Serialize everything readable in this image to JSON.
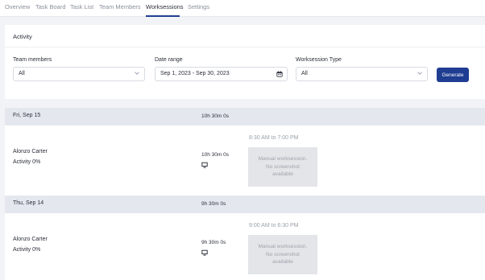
{
  "tabs": [
    {
      "label": "Overview"
    },
    {
      "label": "Task Board"
    },
    {
      "label": "Task List"
    },
    {
      "label": "Team Members"
    },
    {
      "label": "Worksessions"
    },
    {
      "label": "Settings"
    }
  ],
  "active_tab": "Worksessions",
  "panel": {
    "title": "Activity"
  },
  "filters": {
    "team_members": {
      "label": "Team members",
      "value": "All"
    },
    "date_range": {
      "label": "Date range",
      "value": "Sep 1, 2023 - Sep 30, 2023"
    },
    "worksession_type": {
      "label": "Worksession Type",
      "value": "All"
    },
    "generate_label": "Generate"
  },
  "days": [
    {
      "date": "Fri, Sep 15",
      "total": "10h 30m 0s",
      "entry": {
        "name": "Alonzo Carter",
        "activity": "Activity 0%",
        "duration": "10h 30m 0s",
        "time_range": "8:30 AM to 7:00 PM",
        "card_line1": "Manual worksession.",
        "card_line2": "No screenshot",
        "card_line3": "available"
      }
    },
    {
      "date": "Thu, Sep 14",
      "total": "9h 30m 0s",
      "entry": {
        "name": "Alonzo Carter",
        "activity": "Activity 0%",
        "duration": "9h 30m 0s",
        "time_range": "9:00 AM to 6:30 PM",
        "card_line1": "Manual worksession.",
        "card_line2": "No screenshot",
        "card_line3": "available"
      }
    }
  ],
  "colors": {
    "accent": "#1f3d91",
    "header_band": "#e4e8ee",
    "page_bg": "#f2f3f6"
  },
  "icons": {
    "date_picker": "calendar-icon",
    "device": "monitor-icon",
    "dropdown": "chevron-down-icon"
  }
}
